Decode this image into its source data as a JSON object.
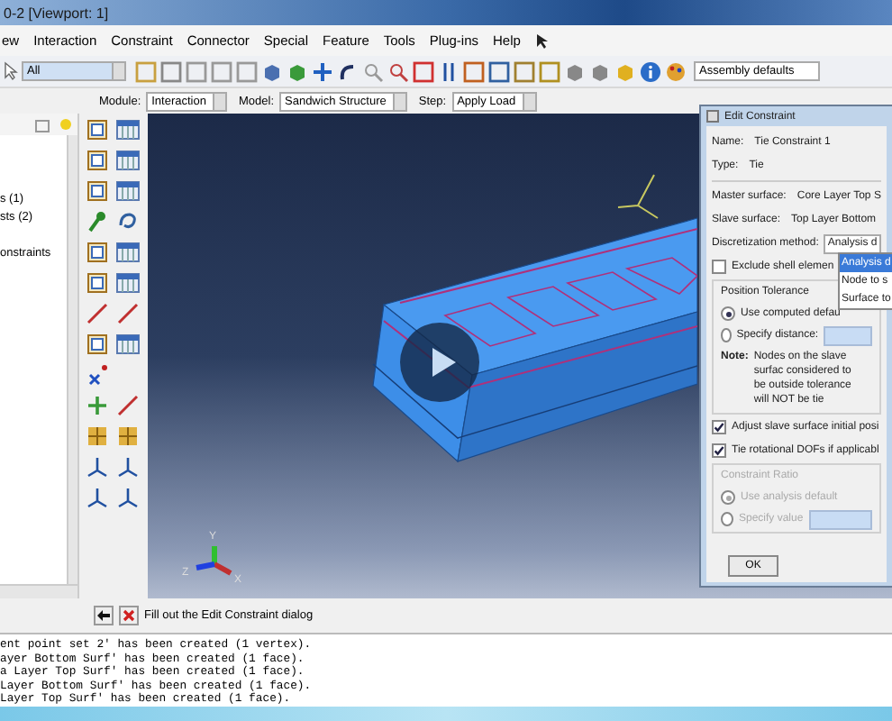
{
  "window": {
    "title": "0-2 [Viewport: 1]"
  },
  "menu": [
    "ew",
    "Interaction",
    "Constraint",
    "Connector",
    "Special",
    "Feature",
    "Tools",
    "Plug-ins",
    "Help"
  ],
  "toolbar": {
    "selection_filter": "All",
    "render_style": "Assembly defaults"
  },
  "context_bar": {
    "module_label": "Module:",
    "module": "Interaction",
    "model_label": "Model:",
    "model": "Sandwich Structure",
    "step_label": "Step:",
    "step": "Apply Load"
  },
  "model_tree": {
    "items": [
      "s (1)",
      "sts (2)",
      "onstraints"
    ]
  },
  "viewport": {
    "triad_labels": [
      "Y",
      "Z",
      "X"
    ]
  },
  "dialog": {
    "title": "Edit Constraint",
    "name_label": "Name:",
    "name": "Tie Constraint 1",
    "type_label": "Type:",
    "type": "Tie",
    "master_label": "Master surface:",
    "master": "Core Layer Top S",
    "slave_label": "Slave surface:",
    "slave": "Top Layer Bottom",
    "discretization_label": "Discretization method:",
    "discretization": "Analysis d",
    "discretization_options": [
      {
        "label": "Analysis d",
        "selected": true
      },
      {
        "label": "Node to s",
        "selected": false
      },
      {
        "label": "Surface to",
        "selected": false
      }
    ],
    "exclude_shell": {
      "label": "Exclude shell elemen",
      "checked": false
    },
    "position_tolerance": {
      "title": "Position Tolerance",
      "options": [
        {
          "label": "Use computed defau",
          "selected": true
        },
        {
          "label": "Specify distance:",
          "selected": false
        }
      ]
    },
    "note_label": "Note:",
    "note": "Nodes on the slave surfac considered to be outside tolerance will NOT be tie",
    "adjust": {
      "label": "Adjust slave surface initial posi",
      "checked": true
    },
    "tie_rotational": {
      "label": "Tie rotational DOFs if applicabl",
      "checked": true
    },
    "constraint_ratio": {
      "title": "Constraint Ratio",
      "disabled": true,
      "options": [
        {
          "label": "Use analysis default",
          "selected": true
        },
        {
          "label": "Specify value",
          "selected": false
        }
      ]
    },
    "ok": "OK"
  },
  "prompt": "Fill out the Edit Constraint dialog",
  "messages": [
    "ent point set 2' has been created (1 vertex).",
    "ayer Bottom Surf' has been created (1 face).",
    "a Layer Top Surf' has been created (1 face).",
    "Layer Bottom Surf' has been created (1 face).",
    "Layer Top Surf' has been created (1 face)."
  ]
}
